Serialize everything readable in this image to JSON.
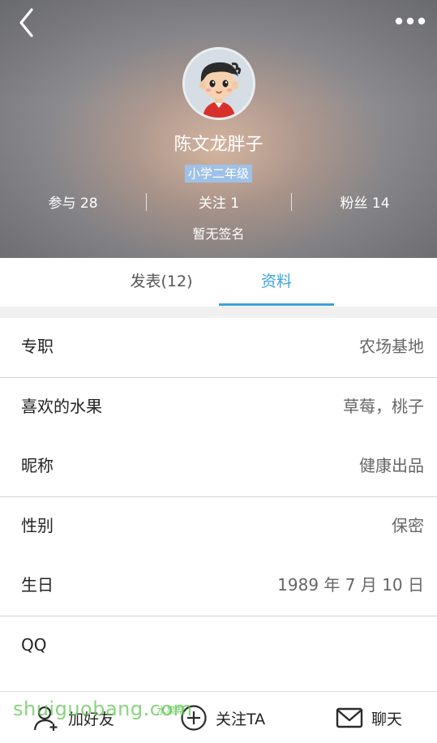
{
  "header": {
    "username": "陈文龙胖子",
    "grade": "小学二年级",
    "stats": [
      {
        "label": "参与 28"
      },
      {
        "label": "关注 1"
      },
      {
        "label": "粉丝 14"
      }
    ],
    "signature": "暂无签名"
  },
  "tabs": [
    {
      "label": "发表(12)",
      "active": false
    },
    {
      "label": "资料",
      "active": true
    }
  ],
  "profile": {
    "rows": [
      {
        "label": "专职",
        "value": "农场基地"
      },
      {
        "label": "喜欢的水果",
        "value": "草莓，桃子"
      },
      {
        "label": "昵称",
        "value": "健康出品"
      },
      {
        "label": "性别",
        "value": "保密"
      },
      {
        "label": "生日",
        "value": "1989 年 7 月 10 日"
      },
      {
        "label": "QQ",
        "value": ""
      }
    ]
  },
  "bottom_bar": {
    "add_friend": "加好友",
    "follow": "关注TA",
    "chat": "聊天"
  },
  "watermark": {
    "main": "shuiguobang.com",
    "small": "水果帮",
    "com": ".com"
  },
  "colors": {
    "accent": "#3aa3dc",
    "badge": "#9fc1e8",
    "watermark": "#5cc44c"
  },
  "icons": [
    "back-arrow-icon",
    "more-dots-icon",
    "add-friend-icon",
    "follow-plus-icon",
    "chat-envelope-icon"
  ]
}
